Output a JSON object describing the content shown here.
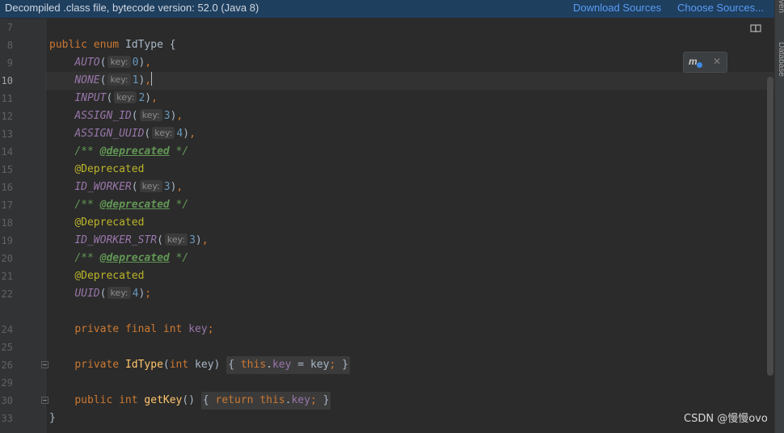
{
  "banner": {
    "message": "Decompiled .class file, bytecode version: 52.0 (Java 8)",
    "download_sources": "Download Sources",
    "choose_sources": "Choose Sources..."
  },
  "side_tabs": {
    "maven": "Maven",
    "database": "Database"
  },
  "watermark": "CSDN @慢慢ovo",
  "line_numbers": [
    "7",
    "8",
    "9",
    "10",
    "11",
    "12",
    "13",
    "14",
    "15",
    "16",
    "17",
    "18",
    "19",
    "20",
    "21",
    "22",
    "24",
    "25",
    "26",
    "29",
    "30",
    "33"
  ],
  "current_line": "10",
  "code": {
    "l8": [
      "public",
      "enum",
      "IdType",
      "{"
    ],
    "hint_label": "key:",
    "entries": [
      {
        "name": "AUTO",
        "value": "0"
      },
      {
        "name": "NONE",
        "value": "1"
      },
      {
        "name": "INPUT",
        "value": "2"
      },
      {
        "name": "ASSIGN_ID",
        "value": "3"
      },
      {
        "name": "ASSIGN_UUID",
        "value": "4"
      },
      {
        "name": "ID_WORKER",
        "value": "3"
      },
      {
        "name": "ID_WORKER_STR",
        "value": "3"
      },
      {
        "name": "UUID",
        "value": "4"
      }
    ],
    "doc_open": "/**",
    "doc_tag": "@deprecated",
    "doc_close": "*/",
    "annotation": "@Deprecated",
    "field_decl": [
      "private",
      "final",
      "int",
      "key"
    ],
    "ctor": [
      "private",
      "IdType",
      "int",
      "key",
      "this",
      "key",
      "key"
    ],
    "getter": [
      "public",
      "int",
      "getKey",
      "return",
      "this",
      "key"
    ],
    "closing_brace": "}"
  }
}
